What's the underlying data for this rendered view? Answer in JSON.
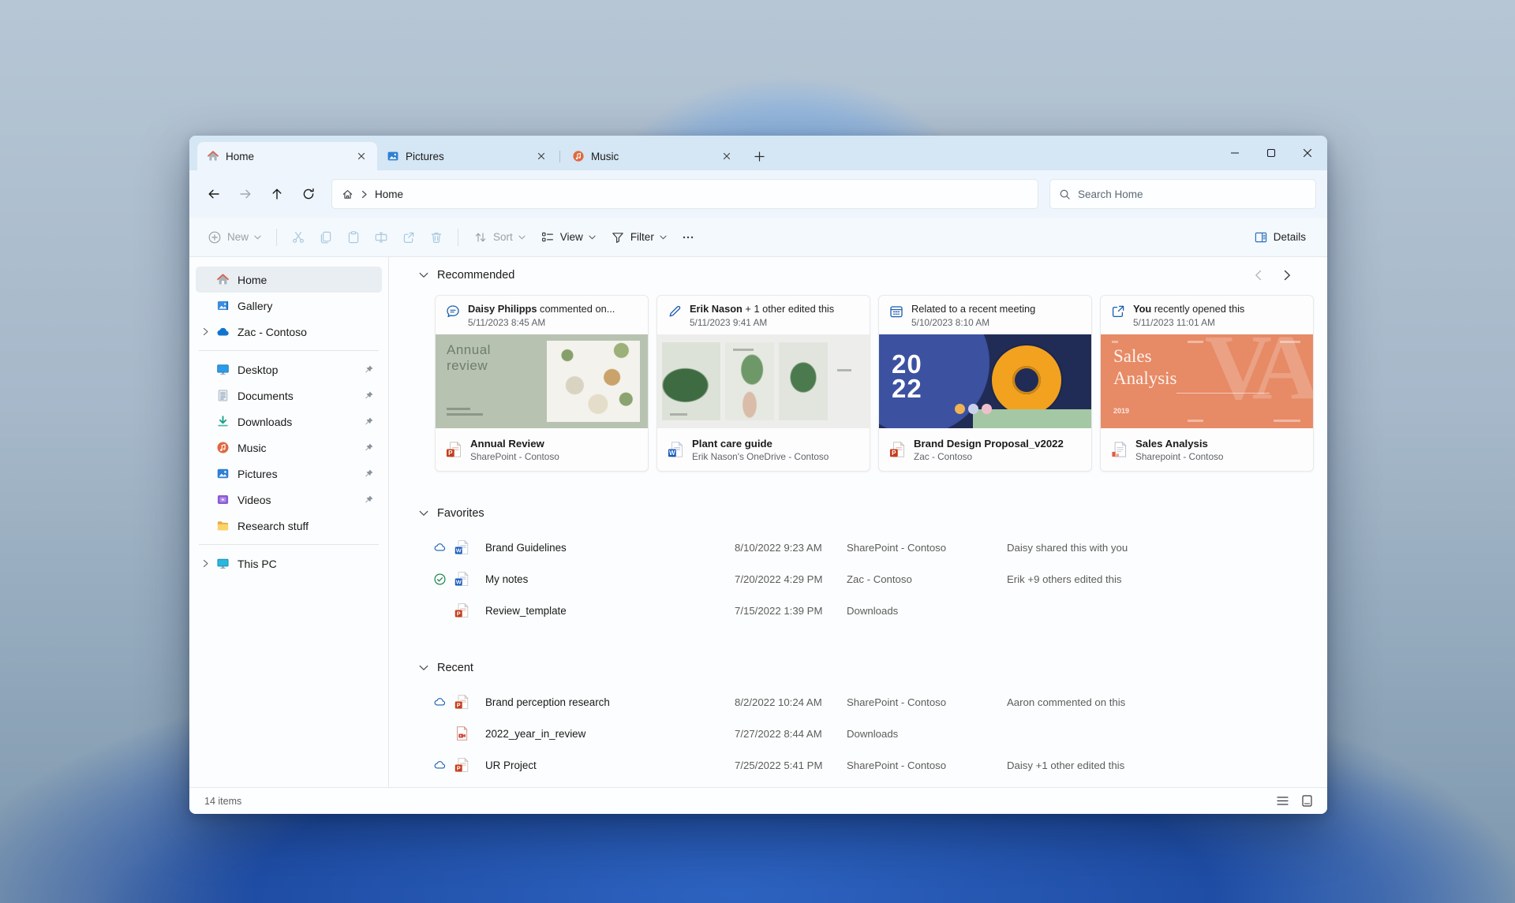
{
  "window": {
    "tabs": [
      {
        "label": "Home",
        "icon": "home-icon",
        "active": true
      },
      {
        "label": "Pictures",
        "icon": "pictures-icon",
        "active": false
      },
      {
        "label": "Music",
        "icon": "music-icon",
        "active": false
      }
    ]
  },
  "nav": {
    "breadcrumb": "Home",
    "search_placeholder": "Search Home"
  },
  "toolbar": {
    "new": "New",
    "sort": "Sort",
    "view": "View",
    "filter": "Filter",
    "details": "Details",
    "disabled_icons": [
      "cut-icon",
      "copy-icon",
      "paste-icon",
      "rename-icon",
      "share-icon",
      "delete-icon"
    ],
    "disabled_icon_color": "#a9c9e0"
  },
  "sidebar": {
    "items_top": [
      {
        "label": "Home",
        "icon": "home-icon",
        "selected": true
      },
      {
        "label": "Gallery",
        "icon": "gallery-icon"
      },
      {
        "label": "Zac - Contoso",
        "icon": "onedrive-cloud-icon",
        "expandable": true
      }
    ],
    "items_pinned": [
      {
        "label": "Desktop",
        "icon": "desktop-icon",
        "pinned": true
      },
      {
        "label": "Documents",
        "icon": "documents-icon",
        "pinned": true
      },
      {
        "label": "Downloads",
        "icon": "downloads-icon",
        "pinned": true
      },
      {
        "label": "Music",
        "icon": "music-icon",
        "pinned": true
      },
      {
        "label": "Pictures",
        "icon": "pictures-icon",
        "pinned": true
      },
      {
        "label": "Videos",
        "icon": "videos-icon",
        "pinned": true
      },
      {
        "label": "Research stuff",
        "icon": "folder-icon",
        "pinned": false
      }
    ],
    "items_bottom": [
      {
        "label": "This PC",
        "icon": "this-pc-icon",
        "expandable": true
      }
    ]
  },
  "recommended": {
    "title": "Recommended",
    "cards": [
      {
        "event_icon": "comment-icon",
        "actor": "Daisy Philipps",
        "event": " commented on...",
        "date": "5/11/2023 8:45 AM",
        "file": "Annual Review",
        "location": "SharePoint - Contoso",
        "file_icon": "powerpoint-file-icon",
        "thumb_title": "Annual review"
      },
      {
        "event_icon": "edit-pencil-icon",
        "actor": "Erik Nason",
        "event": " + 1 other edited this",
        "date": "5/11/2023 9:41 AM",
        "file": "Plant care guide",
        "location": "Erik Nason's OneDrive - Contoso",
        "file_icon": "word-file-icon"
      },
      {
        "event_icon": "meeting-calendar-icon",
        "actor": "",
        "event": "Related to a recent meeting",
        "date": "5/10/2023 8:10 AM",
        "file": "Brand Design Proposal_v2022",
        "location": "Zac - Contoso",
        "file_icon": "powerpoint-file-icon",
        "thumb_year_top": "20",
        "thumb_year_bottom": "22"
      },
      {
        "event_icon": "opened-icon",
        "actor": "You",
        "event": " recently opened this",
        "date": "5/11/2023 11:01 AM",
        "file": "Sales Analysis",
        "location": "Sharepoint - Contoso",
        "file_icon": "document-file-icon",
        "thumb_title": "Sales Analysis",
        "thumb_watermark": "VA",
        "thumb_year": "2019"
      }
    ]
  },
  "favorites": {
    "title": "Favorites",
    "rows": [
      {
        "sync_icon": "cloud-icon",
        "file_icon": "word-file-icon",
        "name": "Brand Guidelines",
        "date": "8/10/2022 9:23 AM",
        "location": "SharePoint - Contoso",
        "activity": "Daisy shared this with you"
      },
      {
        "sync_icon": "synced-check-icon",
        "file_icon": "word-file-icon",
        "name": "My notes",
        "date": "7/20/2022 4:29 PM",
        "location": "Zac - Contoso",
        "activity": "Erik +9 others edited this"
      },
      {
        "sync_icon": "",
        "file_icon": "powerpoint-file-icon",
        "name": "Review_template",
        "date": "7/15/2022 1:39 PM",
        "location": "Downloads",
        "activity": ""
      }
    ]
  },
  "recent": {
    "title": "Recent",
    "rows": [
      {
        "sync_icon": "cloud-icon",
        "file_icon": "powerpoint-file-icon",
        "name": "Brand perception research",
        "date": "8/2/2022 10:24 AM",
        "location": "SharePoint - Contoso",
        "activity": "Aaron commented on this"
      },
      {
        "sync_icon": "",
        "file_icon": "video-file-icon",
        "name": "2022_year_in_review",
        "date": "7/27/2022 8:44 AM",
        "location": "Downloads",
        "activity": ""
      },
      {
        "sync_icon": "cloud-icon",
        "file_icon": "powerpoint-file-icon",
        "name": "UR Project",
        "date": "7/25/2022 5:41 PM",
        "location": "SharePoint - Contoso",
        "activity": "Daisy +1 other edited this"
      }
    ]
  },
  "statusbar": {
    "count": "14 items"
  }
}
